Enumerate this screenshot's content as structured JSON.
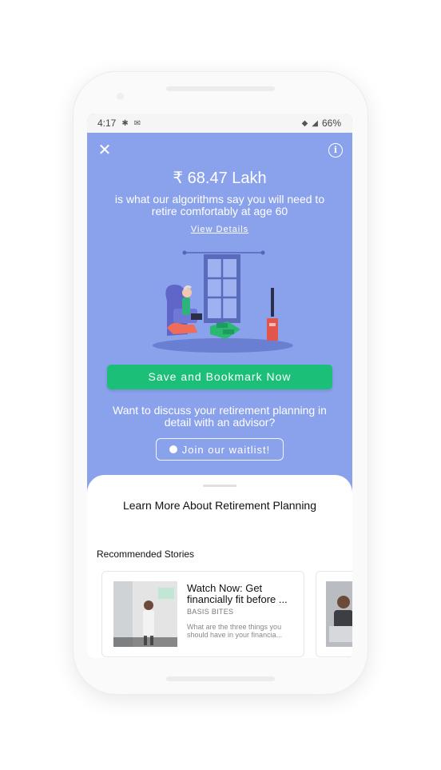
{
  "status_bar": {
    "time": "4:17",
    "battery": "66%"
  },
  "hero": {
    "amount": "₹ 68.47 Lakh",
    "subtitle": "is what our algorithms say you will need to retire comfortably at age 60",
    "view_details": "View Details",
    "save_button": "Save and Bookmark Now",
    "discuss": "Want to discuss your retirement planning in detail with an advisor?",
    "waitlist_button": "Join our waitlist!"
  },
  "sheet": {
    "title": "Learn More About Retirement Planning",
    "section_title": "Recommended Stories",
    "stories": [
      {
        "title": "Watch Now: Get financially fit before ...",
        "source": "BASIS BITES",
        "description": "What are the three things you should have in your financia..."
      }
    ]
  },
  "colors": {
    "hero_bg": "#8aa1ec",
    "primary_button": "#1bbf77",
    "sheet_bg": "#ffffff"
  },
  "icons": [
    "close-icon",
    "info-icon",
    "stopwatch-icon",
    "wifi-icon",
    "signal-icon",
    "battery-icon",
    "slack-icon",
    "mail-icon"
  ]
}
